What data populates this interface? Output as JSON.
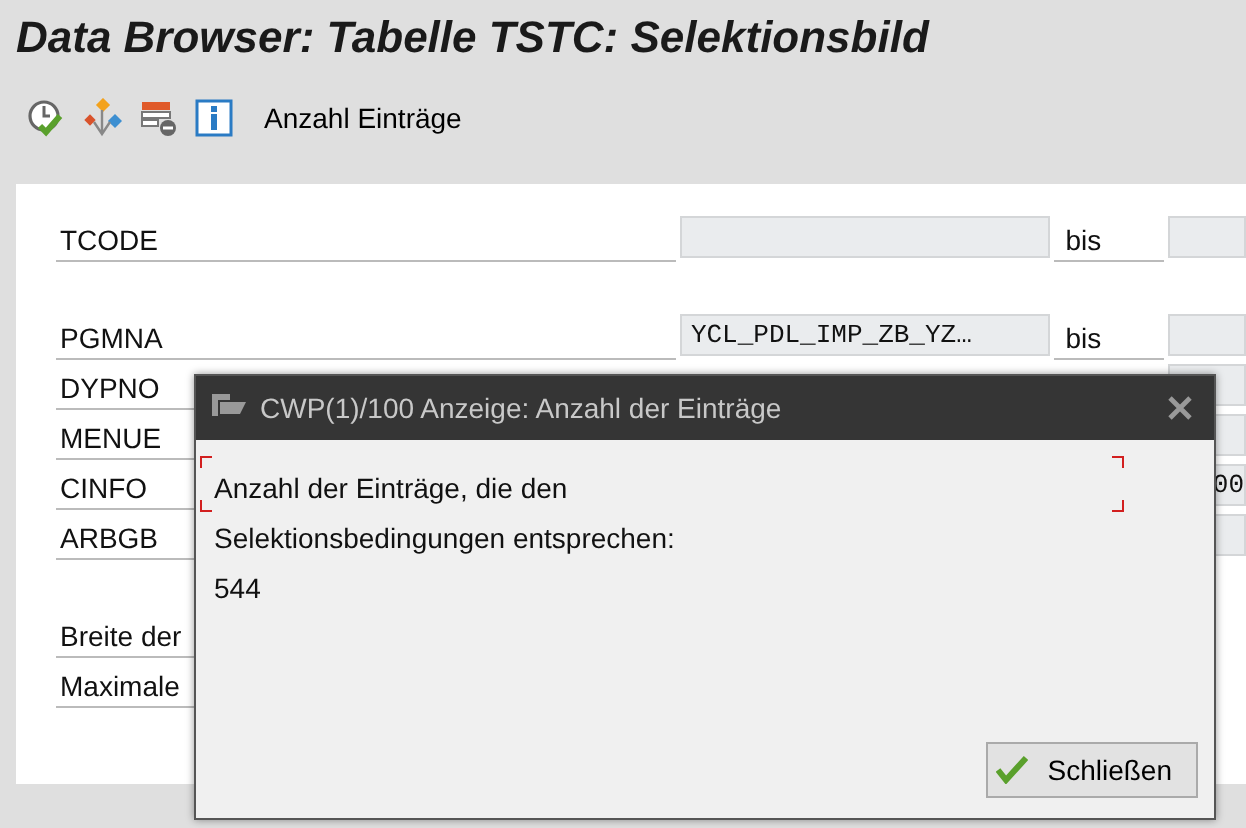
{
  "window": {
    "title": "Data Browser: Tabelle TSTC: Selektionsbild"
  },
  "toolbar": {
    "buttons": [
      {
        "kind": "execute"
      },
      {
        "kind": "variants"
      },
      {
        "kind": "fields"
      },
      {
        "kind": "info"
      }
    ],
    "label": "Anzahl Einträge"
  },
  "form": {
    "groups": [
      [
        {
          "label": "TCODE",
          "kind": "range",
          "to_label": "bis"
        }
      ],
      [
        {
          "label": "PGMNA",
          "kind": "range",
          "low": "YCL_PDL_IMP_ZB_YZ…",
          "to_label": "bis"
        },
        {
          "label": "DYPNO",
          "kind": "high_only"
        },
        {
          "label": "MENUE",
          "kind": "high_only"
        },
        {
          "label": "CINFO",
          "kind": "high_only",
          "high": "00"
        },
        {
          "label": "ARBGB",
          "kind": "high_only"
        }
      ],
      [
        {
          "label": "Breite der",
          "kind": "param"
        },
        {
          "label": "Maximale",
          "kind": "param"
        }
      ]
    ]
  },
  "dialog": {
    "title": "CWP(1)/100 Anzeige: Anzahl der Einträge",
    "message_lines": [
      "Anzahl der Einträge, die den",
      "Selektionsbedingungen entsprechen:"
    ],
    "count": "544",
    "button": "Schließen"
  }
}
